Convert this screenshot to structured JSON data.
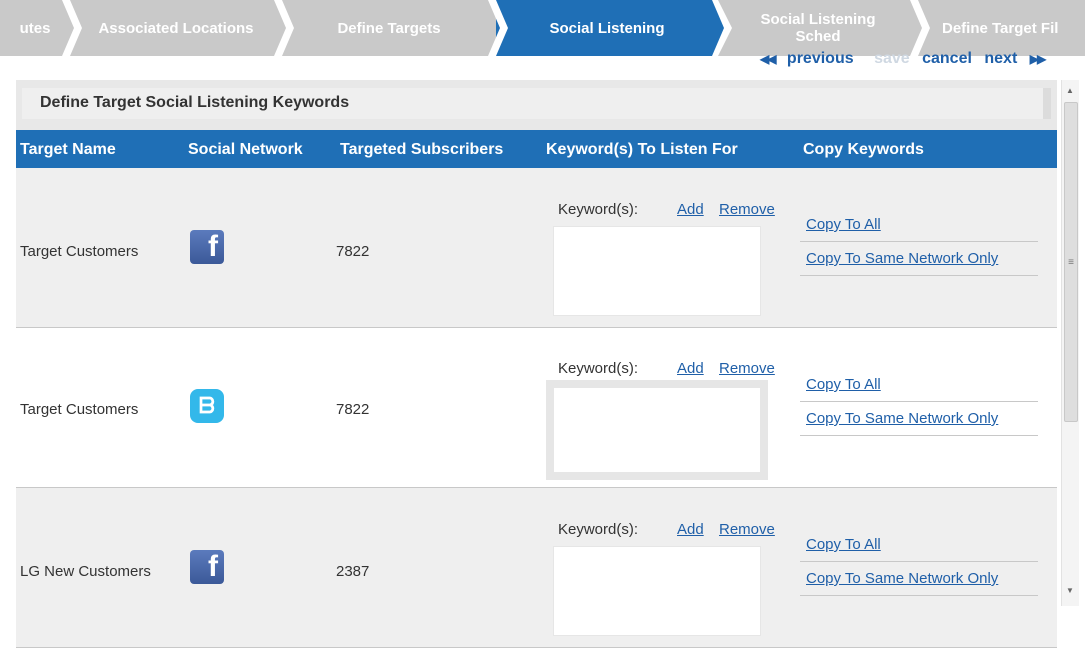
{
  "wizard": {
    "steps": [
      {
        "label": "utes",
        "state": "inactive"
      },
      {
        "label": "Associated Locations",
        "state": "inactive"
      },
      {
        "label": "Define Targets",
        "state": "inactive"
      },
      {
        "label": "Social Listening",
        "state": "active"
      },
      {
        "label": "Social Listening Sched",
        "state": "inactive"
      },
      {
        "label": "Define Target Fil",
        "state": "inactive"
      }
    ]
  },
  "nav": {
    "previous": "previous",
    "save": "save",
    "cancel": "cancel",
    "next": "next"
  },
  "panel": {
    "title": "Define Target Social Listening Keywords"
  },
  "table": {
    "headers": [
      "Target Name",
      "Social Network",
      "Targeted Subscribers",
      "Keyword(s) To Listen For",
      "Copy Keywords"
    ],
    "rows": [
      {
        "name": "Target Customers",
        "network": "facebook-icon",
        "subscribers": "7822",
        "kw_label": "Keyword(s):",
        "add": "Add",
        "remove": "Remove",
        "copy_all": "Copy To All",
        "copy_same": "Copy To Same Network Only"
      },
      {
        "name": "Target Customers",
        "network": "twitter-icon",
        "subscribers": "7822",
        "kw_label": "Keyword(s):",
        "add": "Add",
        "remove": "Remove",
        "copy_all": "Copy To All",
        "copy_same": "Copy To Same Network Only"
      },
      {
        "name": "LG New Customers",
        "network": "facebook-icon",
        "subscribers": "2387",
        "kw_label": "Keyword(s):",
        "add": "Add",
        "remove": "Remove",
        "copy_all": "Copy To All",
        "copy_same": "Copy To Same Network Only"
      }
    ]
  },
  "colors": {
    "accent": "#1f6fb6",
    "inactive_step": "#c9c9c9",
    "link": "#1f5fa8"
  }
}
